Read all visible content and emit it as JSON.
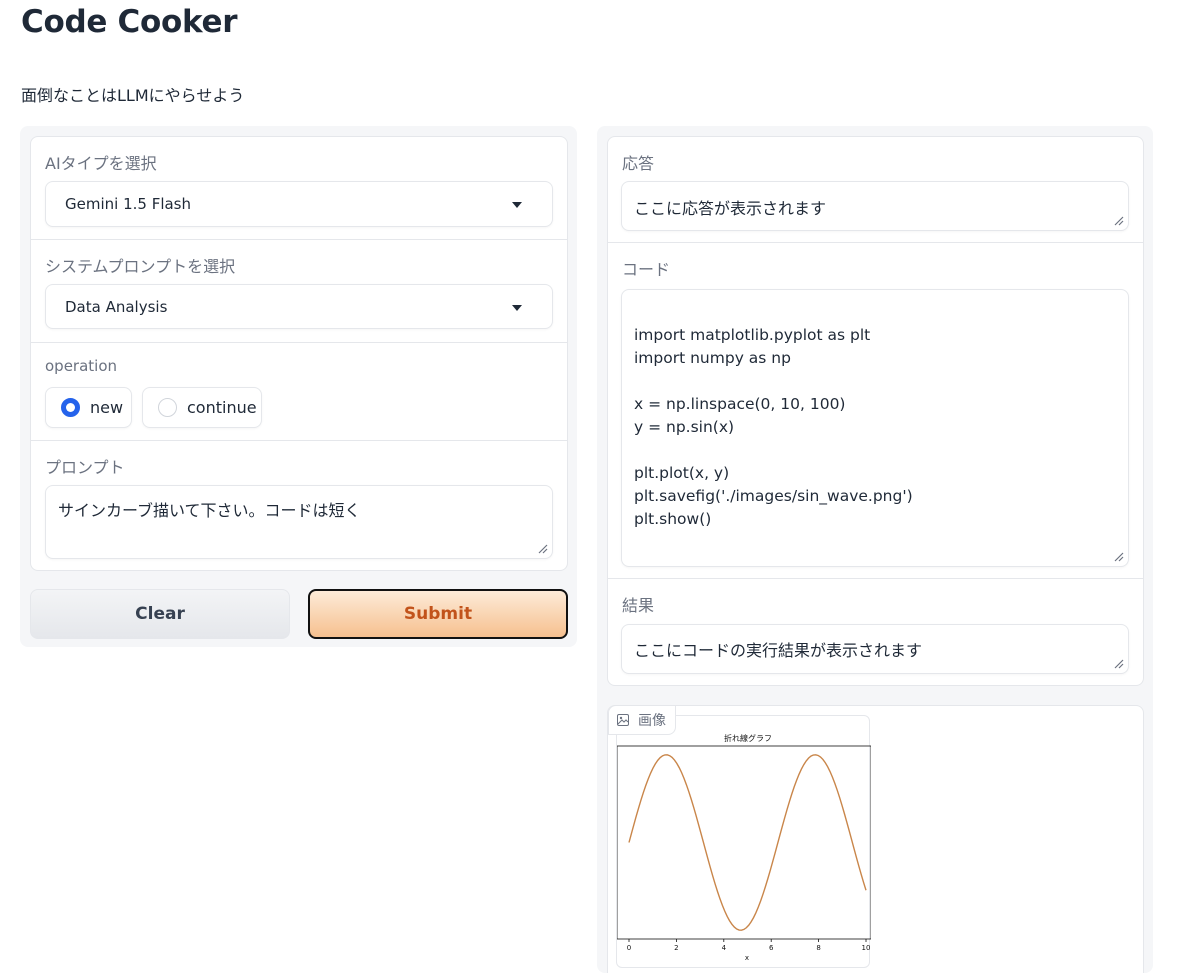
{
  "app": {
    "title": "Code Cooker",
    "subtitle": "面倒なことはLLMにやらせよう"
  },
  "left": {
    "ai_type": {
      "label": "AIタイプを選択",
      "value": "Gemini 1.5 Flash"
    },
    "system_prompt": {
      "label": "システムプロンプトを選択",
      "value": "Data Analysis"
    },
    "operation": {
      "label": "operation",
      "options": [
        {
          "label": "new",
          "selected": true
        },
        {
          "label": "continue",
          "selected": false
        }
      ]
    },
    "prompt": {
      "label": "プロンプト",
      "value": "サインカーブ描いて下さい。コードは短く"
    },
    "buttons": {
      "clear": "Clear",
      "submit": "Submit"
    }
  },
  "right": {
    "response": {
      "label": "応答",
      "value": "ここに応答が表示されます"
    },
    "code": {
      "label": "コード",
      "value": "import matplotlib.pyplot as plt\nimport numpy as np\n\nx = np.linspace(0, 10, 100)\ny = np.sin(x)\n\nplt.plot(x, y)\nplt.savefig('./images/sin_wave.png')\nplt.show()"
    },
    "result": {
      "label": "結果",
      "value": "ここにコードの実行結果が表示されます"
    },
    "image": {
      "label": "画像",
      "icon": "image-icon"
    }
  },
  "chart_data": {
    "type": "line",
    "title": "折れ線グラフ",
    "xlabel": "x",
    "ylabel": "",
    "xlim": [
      0,
      10
    ],
    "ylim": [
      -1.1,
      1.1
    ],
    "x_ticks": [
      "0",
      "2",
      "4",
      "6",
      "8",
      "10"
    ],
    "series": [
      {
        "function": "sin(x)",
        "x_start": 0,
        "x_end": 10,
        "points": 100,
        "color": "#c9864a"
      }
    ]
  },
  "colors": {
    "accent": "#2563eb",
    "submit_text": "#c2531b",
    "line": "#c9864a"
  }
}
